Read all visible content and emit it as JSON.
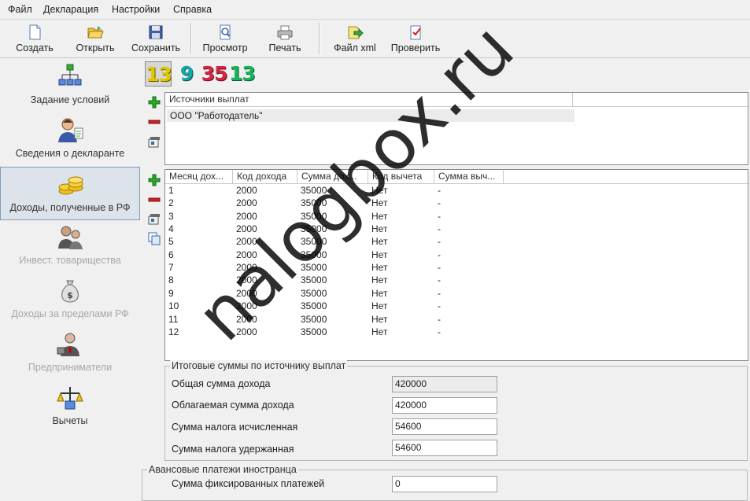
{
  "menu": [
    "Файл",
    "Декларация",
    "Настройки",
    "Справка"
  ],
  "toolbar": {
    "create": "Создать",
    "open": "Открыть",
    "save": "Сохранить",
    "preview": "Просмотр",
    "print": "Печать",
    "xml": "Файл xml",
    "check": "Проверить"
  },
  "sidebar": [
    {
      "label": "Задание условий",
      "icon": "hierarchy-icon",
      "state": "normal"
    },
    {
      "label": "Сведения о декларанте",
      "icon": "person-icon",
      "state": "normal"
    },
    {
      "label": "Доходы, полученные в РФ",
      "icon": "coins-icon",
      "state": "active"
    },
    {
      "label": "Инвест. товарищества",
      "icon": "partners-icon",
      "state": "disabled"
    },
    {
      "label": "Доходы за пределами РФ",
      "icon": "money-bag-icon",
      "state": "disabled"
    },
    {
      "label": "Предприниматели",
      "icon": "businessman-icon",
      "state": "disabled"
    },
    {
      "label": "Вычеты",
      "icon": "deductions-icon",
      "state": "normal"
    }
  ],
  "tax_tabs": [
    {
      "label": "13",
      "color": "#d4c000",
      "active": true
    },
    {
      "label": "9",
      "color": "#15a8a8",
      "active": false
    },
    {
      "label": "35",
      "color": "#c8283c",
      "active": false
    },
    {
      "label": "13",
      "color": "#18b45a",
      "active": false
    }
  ],
  "sources": {
    "header": "Источники выплат",
    "rows": [
      "ООО \"Работодатель\""
    ]
  },
  "income_table": {
    "headers": [
      "Месяц дох...",
      "Код дохода",
      "Сумма дох...",
      "Код вычета",
      "Сумма выч..."
    ],
    "rows": [
      [
        "1",
        "2000",
        "35000",
        "Нет",
        "-"
      ],
      [
        "2",
        "2000",
        "35000",
        "Нет",
        "-"
      ],
      [
        "3",
        "2000",
        "35000",
        "Нет",
        "-"
      ],
      [
        "4",
        "2000",
        "35000",
        "Нет",
        "-"
      ],
      [
        "5",
        "2000",
        "35000",
        "Нет",
        "-"
      ],
      [
        "6",
        "2000",
        "35000",
        "Нет",
        "-"
      ],
      [
        "7",
        "2000",
        "35000",
        "Нет",
        "-"
      ],
      [
        "8",
        "2000",
        "35000",
        "Нет",
        "-"
      ],
      [
        "9",
        "2000",
        "35000",
        "Нет",
        "-"
      ],
      [
        "10",
        "2000",
        "35000",
        "Нет",
        "-"
      ],
      [
        "11",
        "2000",
        "35000",
        "Нет",
        "-"
      ],
      [
        "12",
        "2000",
        "35000",
        "Нет",
        "-"
      ]
    ]
  },
  "totals": {
    "title": "Итоговые суммы по источнику выплат",
    "total_income_label": "Общая сумма дохода",
    "total_income": "420000",
    "taxable_income_label": "Облагаемая сумма дохода",
    "taxable_income": "420000",
    "tax_calculated_label": "Сумма налога исчисленная",
    "tax_calculated": "54600",
    "tax_withheld_label": "Сумма налога удержанная",
    "tax_withheld": "54600"
  },
  "advance": {
    "title": "Авансовые платежи иностранца",
    "fixed_payments_label": "Сумма фиксированных платежей",
    "fixed_payments": "0"
  },
  "watermark": "nalogbox.ru"
}
